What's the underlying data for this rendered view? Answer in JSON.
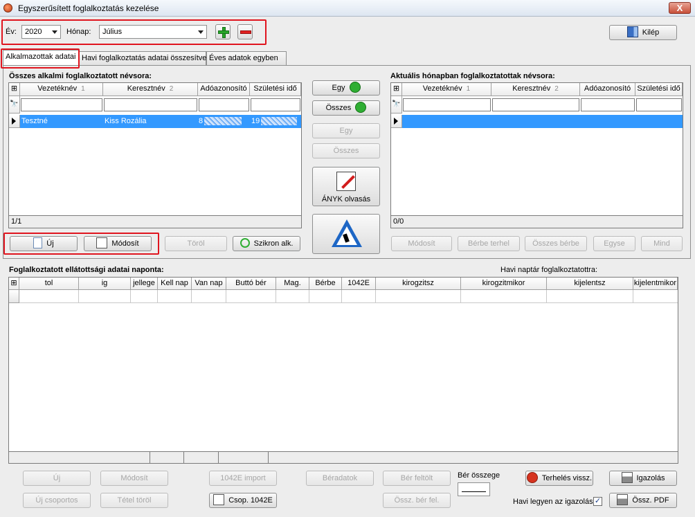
{
  "window": {
    "title": "Egyszerűsített foglalkoztatás kezelése",
    "close_label": "X"
  },
  "top": {
    "year_label": "Év:",
    "year_value": "2020",
    "month_label": "Hónap:",
    "month_value": "Július",
    "exit_label": "Kilép"
  },
  "tabs": [
    {
      "label": "Alkalmazottak adatai",
      "active": true
    },
    {
      "label": "Havi foglalkoztatás adatai összesítve",
      "active": false
    },
    {
      "label": "Éves adatok egyben",
      "active": false
    }
  ],
  "left_grid": {
    "title": "Összes alkalmi foglalkoztatott névsora:",
    "columns": [
      {
        "label": "Vezetéknév",
        "sort": "1"
      },
      {
        "label": "Keresztnév",
        "sort": "2"
      },
      {
        "label": "Adóazonosító",
        "sort": ""
      },
      {
        "label": "Születési idő",
        "sort": ""
      }
    ],
    "rows": [
      {
        "vezeteknev": "Tesztné",
        "keresztnev": "Kiss Rozália",
        "adoazonosito": "8",
        "szuletesi": "19"
      }
    ],
    "status": "1/1"
  },
  "right_grid": {
    "title": "Aktuális hónapban foglalkoztatottak névsora:",
    "columns": [
      {
        "label": "Vezetéknév",
        "sort": "1"
      },
      {
        "label": "Keresztnév",
        "sort": "2"
      },
      {
        "label": "Adóazonosító",
        "sort": ""
      },
      {
        "label": "Születési idő",
        "sort": ""
      }
    ],
    "status": "0/0"
  },
  "middle_buttons": {
    "egy_add": "Egy",
    "osszes_add": "Összes",
    "egy_remove": "Egy",
    "osszes_remove": "Összes",
    "anyk": "ÁNYK olvasás"
  },
  "left_actions": {
    "new": "Új",
    "modify": "Módosít",
    "delete": "Töröl",
    "sync": "Szikron alk."
  },
  "right_actions": {
    "modify": "Módosít",
    "berbe": "Bérbe terhel",
    "osszes_berbe": "Összes bérbe",
    "egyse": "Egyse",
    "mind": "Mind"
  },
  "daily": {
    "title": "Foglalkoztatott ellátottsági adatai naponta:",
    "calendar_label": "Havi naptár foglalkoztatottra:",
    "columns": [
      "tol",
      "ig",
      "jellege",
      "Kell nap",
      "Van nap",
      "Buttó bér",
      "Mag.",
      "Bérbe",
      "1042E",
      "kirogzitsz",
      "kirogzitmikor",
      "kijelentsz",
      "kijelentmikor"
    ]
  },
  "bottom": {
    "new": "Új",
    "modify": "Módosít",
    "import_1042e": "1042E import",
    "beradatok": "Béradatok",
    "ber_feltolt": "Bér feltölt",
    "ber_osszege_label": "Bér összege",
    "terheles_vissz": "Terhelés vissz.",
    "igazolas": "Igazolás",
    "new_group": "Új csoportos",
    "tetel_torol": "Tétel töröl",
    "csop_1042e": "Csop. 1042E",
    "ossz_ber_fel": "Össz. bér fel.",
    "havi_igazolas_label": "Havi legyen az igazolás",
    "havi_igazolas_checked": true,
    "ossz_pdf": "Össz. PDF"
  },
  "colors": {
    "selection": "#3399ff",
    "highlight": "#e0141e"
  }
}
